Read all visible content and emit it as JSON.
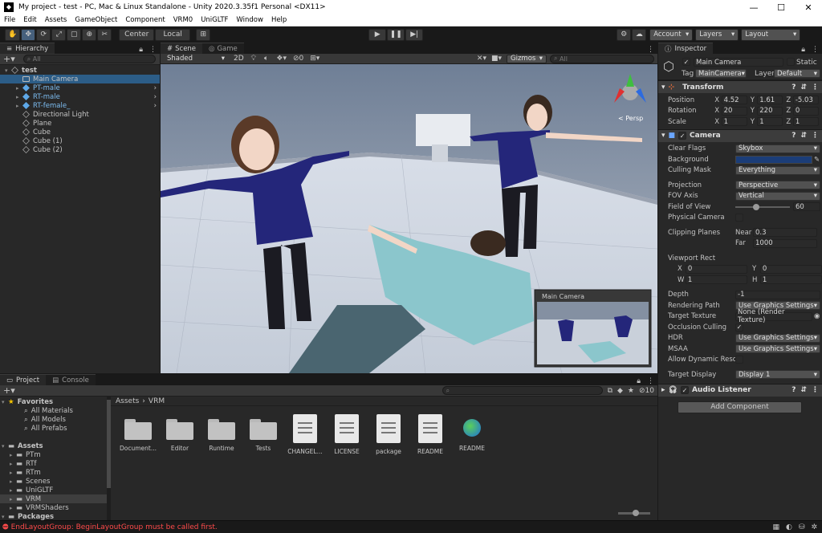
{
  "window": {
    "title": "My project - test - PC, Mac & Linux Standalone - Unity 2020.3.35f1 Personal <DX11>",
    "min": "—",
    "max": "☐",
    "close": "✕"
  },
  "menu": [
    "File",
    "Edit",
    "Assets",
    "GameObject",
    "Component",
    "VRM0",
    "UniGLTF",
    "Window",
    "Help"
  ],
  "toolbar": {
    "center": "Center",
    "local": "Local",
    "account": "Account",
    "layers": "Layers",
    "layout": "Layout"
  },
  "hierarchy": {
    "tab": "Hierarchy",
    "search_placeholder": "All",
    "items": [
      {
        "label": "test",
        "indent": 0,
        "kind": "scene",
        "bold": true
      },
      {
        "label": "Main Camera",
        "indent": 1,
        "kind": "camera",
        "selected": true
      },
      {
        "label": "PT-male",
        "indent": 1,
        "kind": "prefab",
        "arrow": true
      },
      {
        "label": "RT-male",
        "indent": 1,
        "kind": "prefab",
        "arrow": true
      },
      {
        "label": "RT-female_",
        "indent": 1,
        "kind": "prefab",
        "arrow": true
      },
      {
        "label": "Directional Light",
        "indent": 1,
        "kind": "cube"
      },
      {
        "label": "Plane",
        "indent": 1,
        "kind": "cube"
      },
      {
        "label": "Cube",
        "indent": 1,
        "kind": "cube"
      },
      {
        "label": "Cube (1)",
        "indent": 1,
        "kind": "cube"
      },
      {
        "label": "Cube (2)",
        "indent": 1,
        "kind": "cube"
      }
    ]
  },
  "scene": {
    "tab_scene": "Scene",
    "tab_game": "Game",
    "shading": "Shaded",
    "mode2d": "2D",
    "fx_count": "0",
    "gizmos": "Gizmos",
    "search_placeholder": "All",
    "persp": "< Persp",
    "preview_title": "Main Camera"
  },
  "inspector": {
    "tab": "Inspector",
    "object_name": "Main Camera",
    "static_label": "Static",
    "tag_label": "Tag",
    "tag_value": "MainCamera",
    "layer_label": "Layer",
    "layer_value": "Default",
    "transform": {
      "title": "Transform",
      "rows": [
        {
          "label": "Position",
          "x": "4.52",
          "y": "1.61",
          "z": "-5.03"
        },
        {
          "label": "Rotation",
          "x": "20",
          "y": "220",
          "z": "0"
        },
        {
          "label": "Scale",
          "x": "1",
          "y": "1",
          "z": "1"
        }
      ]
    },
    "camera": {
      "title": "Camera",
      "clear_flags_label": "Clear Flags",
      "clear_flags": "Skybox",
      "background_label": "Background",
      "background_color": "#1b3d78",
      "culling_label": "Culling Mask",
      "culling": "Everything",
      "projection_label": "Projection",
      "projection": "Perspective",
      "fov_axis_label": "FOV Axis",
      "fov_axis": "Vertical",
      "fov_label": "Field of View",
      "fov": "60",
      "physical_label": "Physical Camera",
      "clipping_label": "Clipping Planes",
      "near_label": "Near",
      "near": "0.3",
      "far_label": "Far",
      "far": "1000",
      "viewport_label": "Viewport Rect",
      "vx": "0",
      "vy": "0",
      "vw": "1",
      "vh": "1",
      "depth_label": "Depth",
      "depth": "-1",
      "rendering_path_label": "Rendering Path",
      "rendering_path": "Use Graphics Settings",
      "target_tex_label": "Target Texture",
      "target_tex": "None (Render Texture)",
      "occlusion_label": "Occlusion Culling",
      "hdr_label": "HDR",
      "hdr": "Use Graphics Settings",
      "msaa_label": "MSAA",
      "msaa": "Use Graphics Settings",
      "dynres_label": "Allow Dynamic Resol",
      "target_display_label": "Target Display",
      "target_display": "Display 1"
    },
    "audio": {
      "title": "Audio Listener"
    },
    "add_component": "Add Component"
  },
  "project": {
    "tab_project": "Project",
    "tab_console": "Console",
    "badge": "10",
    "breadcrumb_root": "Assets",
    "breadcrumb_leaf": "VRM",
    "tree": [
      {
        "label": "Favorites",
        "indent": 0,
        "kind": "star",
        "bold": true
      },
      {
        "label": "All Materials",
        "indent": 2,
        "kind": "search"
      },
      {
        "label": "All Models",
        "indent": 2,
        "kind": "search"
      },
      {
        "label": "All Prefabs",
        "indent": 2,
        "kind": "search"
      },
      {
        "label": "",
        "indent": 0,
        "kind": "space"
      },
      {
        "label": "Assets",
        "indent": 0,
        "kind": "folder",
        "bold": true
      },
      {
        "label": "PTm",
        "indent": 1,
        "kind": "folder"
      },
      {
        "label": "RTf",
        "indent": 1,
        "kind": "folder"
      },
      {
        "label": "RTm",
        "indent": 1,
        "kind": "folder"
      },
      {
        "label": "Scenes",
        "indent": 1,
        "kind": "folder"
      },
      {
        "label": "UniGLTF",
        "indent": 1,
        "kind": "folder"
      },
      {
        "label": "VRM",
        "indent": 1,
        "kind": "folder",
        "selected": true
      },
      {
        "label": "VRMShaders",
        "indent": 1,
        "kind": "folder"
      },
      {
        "label": "Packages",
        "indent": 0,
        "kind": "folder",
        "bold": true
      }
    ],
    "assets": [
      {
        "label": "Document...",
        "kind": "folder"
      },
      {
        "label": "Editor",
        "kind": "folder"
      },
      {
        "label": "Runtime",
        "kind": "folder"
      },
      {
        "label": "Tests",
        "kind": "folder"
      },
      {
        "label": "CHANGEL...",
        "kind": "doc"
      },
      {
        "label": "LICENSE",
        "kind": "doc"
      },
      {
        "label": "package",
        "kind": "doc"
      },
      {
        "label": "README",
        "kind": "doc"
      },
      {
        "label": "README",
        "kind": "globe"
      }
    ]
  },
  "status": {
    "message": "EndLayoutGroup: BeginLayoutGroup must be called first.",
    "color": "#ff4b4b"
  }
}
